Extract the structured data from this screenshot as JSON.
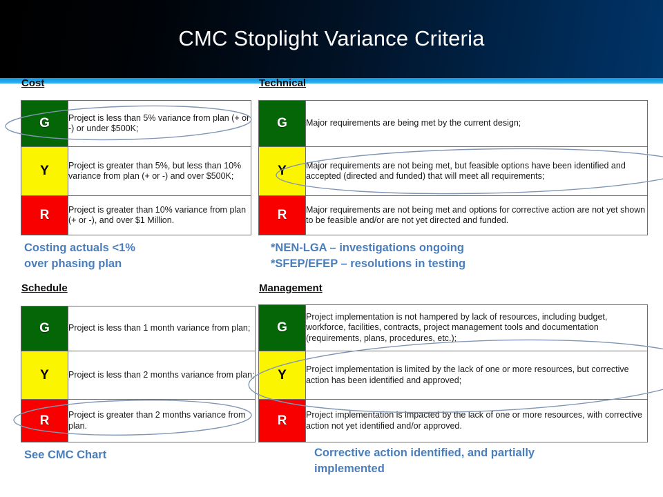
{
  "header": {
    "title": "CMC Stoplight Variance Criteria",
    "accent_color": "#1a9ae0",
    "background_gradient_from": "#000000",
    "background_gradient_to": "#013468"
  },
  "rating_colors": {
    "green": "#056608",
    "yellow": "#fcf500",
    "red": "#f80000"
  },
  "annotation_color": "#4a7ebb",
  "sections": {
    "cost": {
      "heading": "Cost",
      "rows": [
        {
          "rating": "G",
          "description": "Project is less than 5% variance from plan (+ or -) or under $500K;"
        },
        {
          "rating": "Y",
          "description": "Project is greater than 5%, but less than 10% variance from plan (+ or -) and over $500K;"
        },
        {
          "rating": "R",
          "description": "Project is greater than 10% variance from plan (+ or -), and over $1 Million."
        }
      ],
      "note": "Costing actuals <1%\nover phasing plan"
    },
    "technical": {
      "heading": "Technical",
      "rows": [
        {
          "rating": "G",
          "description": "Major requirements are being met by the current design;"
        },
        {
          "rating": "Y",
          "description": "Major requirements are not being met, but feasible options have been identified and accepted (directed and funded) that will meet all requirements;"
        },
        {
          "rating": "R",
          "description": "Major requirements are not being met and options for corrective action are not yet shown to be feasible and/or are not yet directed and funded."
        }
      ],
      "note": "*NEN-LGA – investigations ongoing\n*SFEP/EFEP – resolutions in testing"
    },
    "schedule": {
      "heading": "Schedule",
      "rows": [
        {
          "rating": "G",
          "description": "Project is less than 1 month variance from plan;"
        },
        {
          "rating": "Y",
          "description": "Project is less than 2 months variance from plan;"
        },
        {
          "rating": "R",
          "description": "Project is greater than 2 months variance from plan."
        }
      ],
      "note": "See CMC Chart"
    },
    "management": {
      "heading": "Management",
      "rows": [
        {
          "rating": "G",
          "description": "Project implementation is not hampered by lack of resources, including budget, workforce, facilities, contracts, project management tools and documentation (requirements, plans, procedures, etc.);"
        },
        {
          "rating": "Y",
          "description": "Project implementation is limited by the lack of one or more resources, but corrective action has been identified and approved;"
        },
        {
          "rating": "R",
          "description": "Project implementation is impacted by the lack of one or more resources, with corrective action not yet identified and/or approved."
        }
      ],
      "note": "Corrective action identified, and partially\nimplemented"
    }
  }
}
